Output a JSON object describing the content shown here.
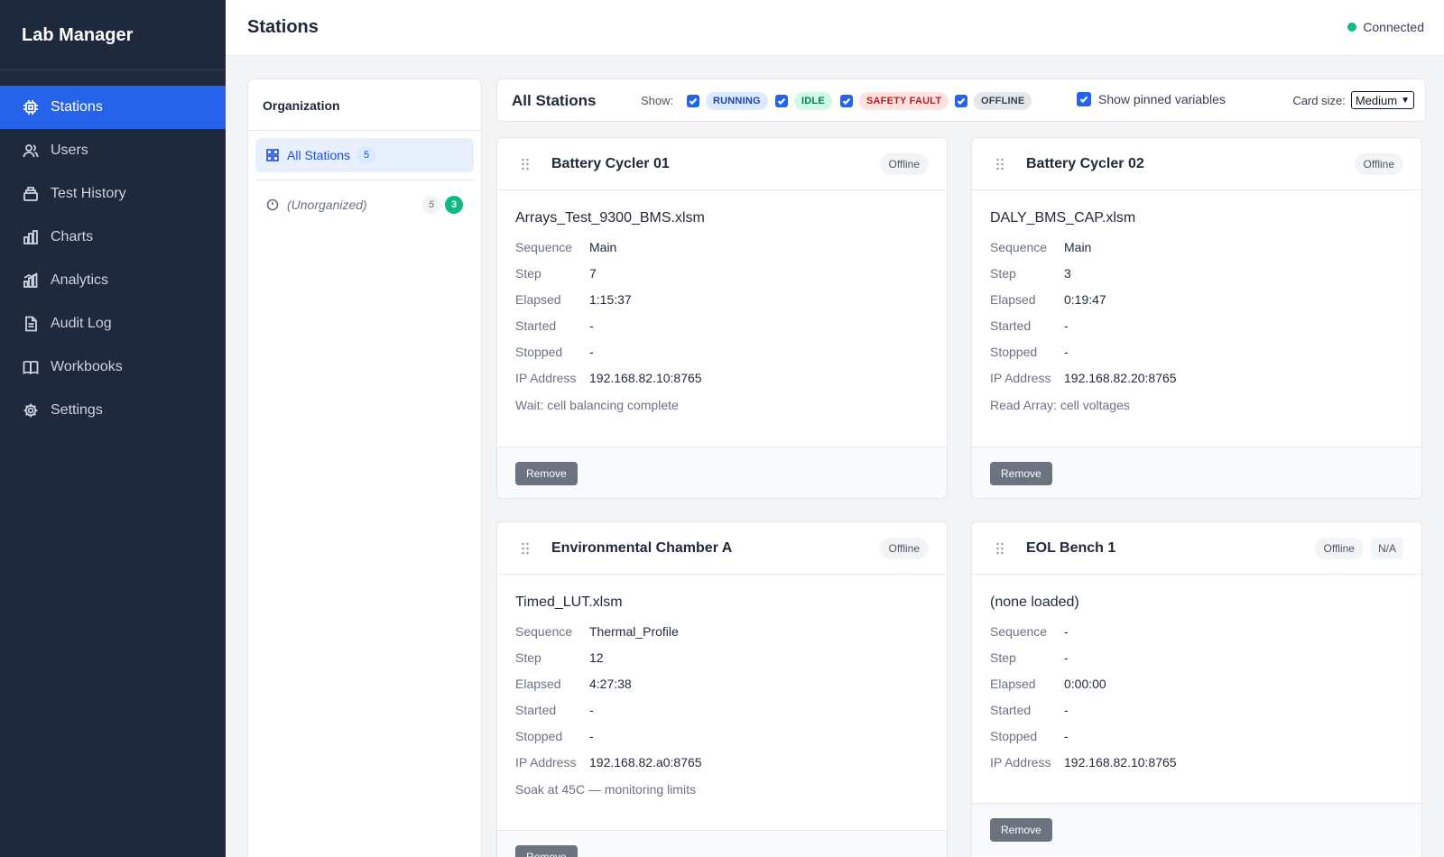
{
  "app": {
    "title": "Lab Manager"
  },
  "sidebar": {
    "items": [
      {
        "label": "Stations",
        "icon": "chip-icon",
        "active": true
      },
      {
        "label": "Users",
        "icon": "users-icon"
      },
      {
        "label": "Test History",
        "icon": "history-icon"
      },
      {
        "label": "Charts",
        "icon": "chart-icon"
      },
      {
        "label": "Analytics",
        "icon": "analytics-icon"
      },
      {
        "label": "Audit Log",
        "icon": "document-icon"
      },
      {
        "label": "Workbooks",
        "icon": "book-icon"
      },
      {
        "label": "Settings",
        "icon": "gear-icon"
      }
    ]
  },
  "header": {
    "title": "Stations",
    "connection": "Connected",
    "connection_color": "#10b981"
  },
  "organization": {
    "title": "Organization",
    "all": {
      "label": "All Stations",
      "count": "5"
    },
    "unorganized": {
      "label": "(Unorganized)",
      "count": "5",
      "active_count": "3"
    }
  },
  "filters": {
    "title": "All Stations",
    "show_label": "Show:",
    "states": [
      {
        "label": "RUNNING",
        "checked": true,
        "bg": "#dbeafe",
        "fg": "#1e40af"
      },
      {
        "label": "IDLE",
        "checked": true,
        "bg": "#d1fae5",
        "fg": "#047857"
      },
      {
        "label": "SAFETY FAULT",
        "checked": true,
        "bg": "#fee2e2",
        "fg": "#b91c1c"
      },
      {
        "label": "OFFLINE",
        "checked": true,
        "bg": "#e5e7eb",
        "fg": "#374151"
      }
    ],
    "pinned_label": "Show pinned variables",
    "pinned_checked": true,
    "card_size_label": "Card size:",
    "card_size_value": "Medium"
  },
  "labels": {
    "sequence": "Sequence",
    "step": "Step",
    "elapsed": "Elapsed",
    "started": "Started",
    "stopped": "Stopped",
    "ip": "IP Address",
    "remove": "Remove"
  },
  "stations": [
    {
      "name": "Battery Cycler 01",
      "status": "Offline",
      "file": "Arrays_Test_9300_BMS.xlsm",
      "sequence": "Main",
      "step": "7",
      "elapsed": "1:15:37",
      "started": "-",
      "stopped": "-",
      "ip": "192.168.82.10:8765",
      "note": "Wait: cell balancing complete"
    },
    {
      "name": "Battery Cycler 02",
      "status": "Offline",
      "file": "DALY_BMS_CAP.xlsm",
      "sequence": "Main",
      "step": "3",
      "elapsed": "0:19:47",
      "started": "-",
      "stopped": "-",
      "ip": "192.168.82.20:8765",
      "note": "Read Array: cell voltages"
    },
    {
      "name": "Environmental Chamber A",
      "status": "Offline",
      "file": "Timed_LUT.xlsm",
      "sequence": "Thermal_Profile",
      "step": "12",
      "elapsed": "4:27:38",
      "started": "-",
      "stopped": "-",
      "ip": "192.168.82.a0:8765",
      "note": "Soak at 45C — monitoring limits"
    },
    {
      "name": "EOL Bench 1",
      "status": "Offline",
      "extra_badge": "N/A",
      "file": "(none loaded)",
      "sequence": "-",
      "step": "-",
      "elapsed": "0:00:00",
      "started": "-",
      "stopped": "-",
      "ip": "192.168.82.10:8765",
      "note": ""
    }
  ]
}
